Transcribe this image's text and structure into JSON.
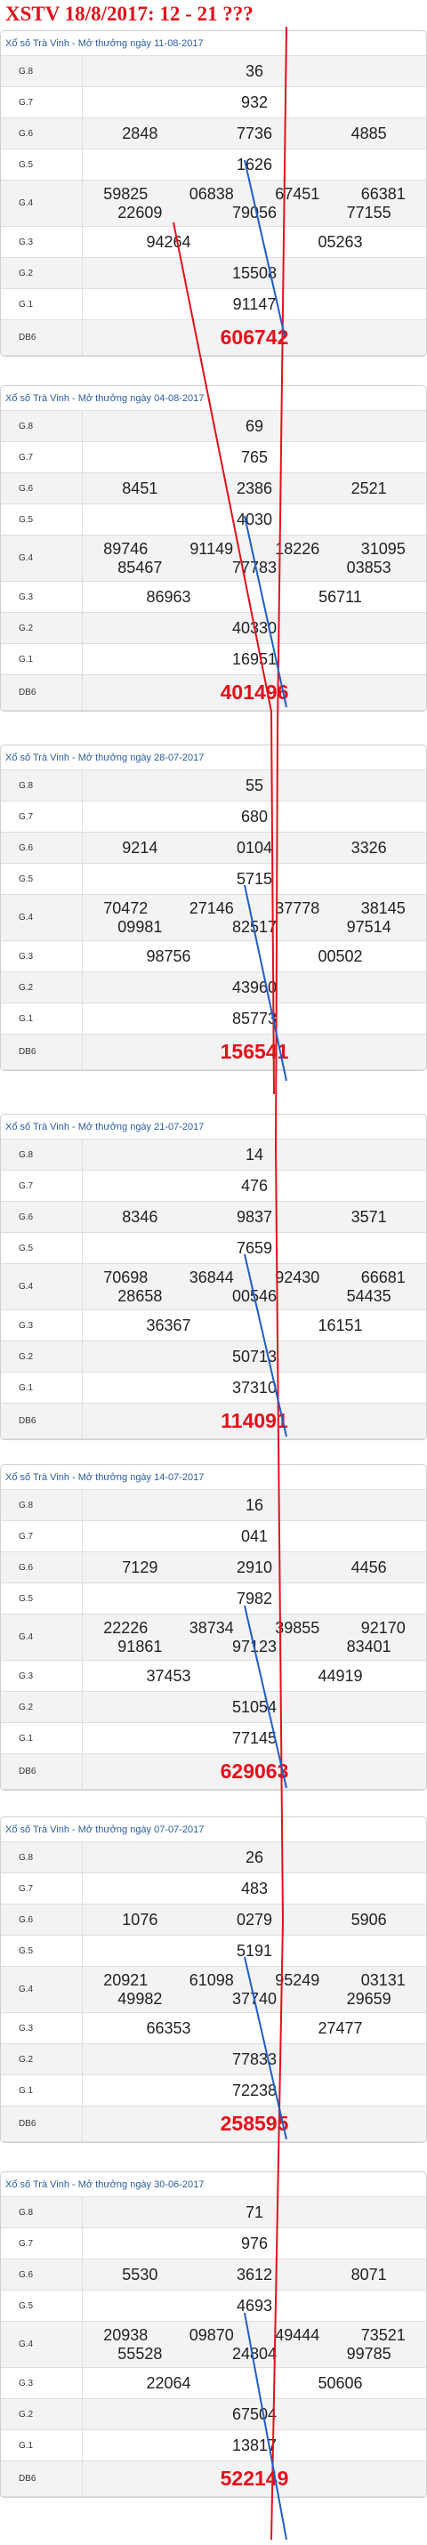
{
  "banner": {
    "title": "XSTV 18/8/2017: 12 - 21 ???"
  },
  "draws": [
    {
      "header": "Xổ số Trà Vinh - Mở thưởng ngày 11-08-2017",
      "rows": [
        {
          "label": "G.8",
          "values": [
            "36"
          ]
        },
        {
          "label": "G.7",
          "values": [
            "932"
          ]
        },
        {
          "label": "G.6",
          "values": [
            "2848",
            "7736",
            "4885"
          ]
        },
        {
          "label": "G.5",
          "values": [
            "1626"
          ]
        },
        {
          "label": "G.4",
          "values": [
            "59825",
            "06838",
            "67451",
            "66381",
            "22609",
            "79056",
            "77155"
          ]
        },
        {
          "label": "G.3",
          "values": [
            "94264",
            "05263"
          ]
        },
        {
          "label": "G.2",
          "values": [
            "15508"
          ]
        },
        {
          "label": "G.1",
          "values": [
            "91147"
          ]
        },
        {
          "label": "DB6",
          "values": [
            "606742"
          ]
        }
      ]
    },
    {
      "header": "Xổ số Trà Vinh - Mở thưởng ngày 04-08-2017",
      "rows": [
        {
          "label": "G.8",
          "values": [
            "69"
          ]
        },
        {
          "label": "G.7",
          "values": [
            "765"
          ]
        },
        {
          "label": "G.6",
          "values": [
            "8451",
            "2386",
            "2521"
          ]
        },
        {
          "label": "G.5",
          "values": [
            "4030"
          ]
        },
        {
          "label": "G.4",
          "values": [
            "89746",
            "91149",
            "18226",
            "31095",
            "85467",
            "77783",
            "03853"
          ]
        },
        {
          "label": "G.3",
          "values": [
            "86963",
            "56711"
          ]
        },
        {
          "label": "G.2",
          "values": [
            "40330"
          ]
        },
        {
          "label": "G.1",
          "values": [
            "16951"
          ]
        },
        {
          "label": "DB6",
          "values": [
            "401496"
          ]
        }
      ]
    },
    {
      "header": "Xổ số Trà Vinh - Mở thưởng ngày 28-07-2017",
      "rows": [
        {
          "label": "G.8",
          "values": [
            "55"
          ]
        },
        {
          "label": "G.7",
          "values": [
            "680"
          ]
        },
        {
          "label": "G.6",
          "values": [
            "9214",
            "0104",
            "3326"
          ]
        },
        {
          "label": "G.5",
          "values": [
            "5715"
          ]
        },
        {
          "label": "G.4",
          "values": [
            "70472",
            "27146",
            "37778",
            "38145",
            "09981",
            "82517",
            "97514"
          ]
        },
        {
          "label": "G.3",
          "values": [
            "98756",
            "00502"
          ]
        },
        {
          "label": "G.2",
          "values": [
            "43960"
          ]
        },
        {
          "label": "G.1",
          "values": [
            "85773"
          ]
        },
        {
          "label": "DB6",
          "values": [
            "156541"
          ]
        }
      ]
    },
    {
      "header": "Xổ số Trà Vinh - Mở thưởng ngày 21-07-2017",
      "rows": [
        {
          "label": "G.8",
          "values": [
            "14"
          ]
        },
        {
          "label": "G.7",
          "values": [
            "476"
          ]
        },
        {
          "label": "G.6",
          "values": [
            "8346",
            "9837",
            "3571"
          ]
        },
        {
          "label": "G.5",
          "values": [
            "7659"
          ]
        },
        {
          "label": "G.4",
          "values": [
            "70698",
            "36844",
            "92430",
            "66681",
            "28658",
            "00546",
            "54435"
          ]
        },
        {
          "label": "G.3",
          "values": [
            "36367",
            "16151"
          ]
        },
        {
          "label": "G.2",
          "values": [
            "50713"
          ]
        },
        {
          "label": "G.1",
          "values": [
            "37310"
          ]
        },
        {
          "label": "DB6",
          "values": [
            "114091"
          ]
        }
      ]
    },
    {
      "header": "Xổ số Trà Vinh - Mở thưởng ngày 14-07-2017",
      "rows": [
        {
          "label": "G.8",
          "values": [
            "16"
          ]
        },
        {
          "label": "G.7",
          "values": [
            "041"
          ]
        },
        {
          "label": "G.6",
          "values": [
            "7129",
            "2910",
            "4456"
          ]
        },
        {
          "label": "G.5",
          "values": [
            "7982"
          ]
        },
        {
          "label": "G.4",
          "values": [
            "22226",
            "38734",
            "39855",
            "92170",
            "91861",
            "97123",
            "83401"
          ]
        },
        {
          "label": "G.3",
          "values": [
            "37453",
            "44919"
          ]
        },
        {
          "label": "G.2",
          "values": [
            "51054"
          ]
        },
        {
          "label": "G.1",
          "values": [
            "77145"
          ]
        },
        {
          "label": "DB6",
          "values": [
            "629063"
          ]
        }
      ]
    },
    {
      "header": "Xổ số Trà Vinh - Mở thưởng ngày 07-07-2017",
      "rows": [
        {
          "label": "G.8",
          "values": [
            "26"
          ]
        },
        {
          "label": "G.7",
          "values": [
            "483"
          ]
        },
        {
          "label": "G.6",
          "values": [
            "1076",
            "0279",
            "5906"
          ]
        },
        {
          "label": "G.5",
          "values": [
            "5191"
          ]
        },
        {
          "label": "G.4",
          "values": [
            "20921",
            "61098",
            "95249",
            "03131",
            "49982",
            "37740",
            "29659"
          ]
        },
        {
          "label": "G.3",
          "values": [
            "66353",
            "27477"
          ]
        },
        {
          "label": "G.2",
          "values": [
            "77833"
          ]
        },
        {
          "label": "G.1",
          "values": [
            "72238"
          ]
        },
        {
          "label": "DB6",
          "values": [
            "258595"
          ]
        }
      ]
    },
    {
      "header": "Xổ số Trà Vinh - Mở thưởng ngày 30-06-2017",
      "rows": [
        {
          "label": "G.8",
          "values": [
            "71"
          ]
        },
        {
          "label": "G.7",
          "values": [
            "976"
          ]
        },
        {
          "label": "G.6",
          "values": [
            "5530",
            "3612",
            "8071"
          ]
        },
        {
          "label": "G.5",
          "values": [
            "4693"
          ]
        },
        {
          "label": "G.4",
          "values": [
            "20938",
            "09870",
            "49444",
            "73521",
            "55528",
            "24804",
            "99785"
          ]
        },
        {
          "label": "G.3",
          "values": [
            "22064",
            "50606"
          ]
        },
        {
          "label": "G.2",
          "values": [
            "67504"
          ]
        },
        {
          "label": "G.1",
          "values": [
            "13817"
          ]
        },
        {
          "label": "DB6",
          "values": [
            "522149"
          ]
        }
      ]
    }
  ],
  "annotation_colors": {
    "up_line": "#e4101a",
    "down_line": "#1e5ec8"
  }
}
